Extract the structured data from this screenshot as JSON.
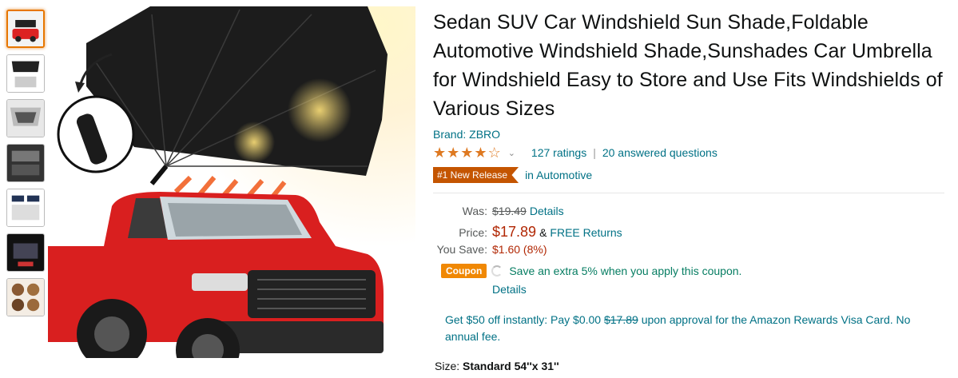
{
  "product": {
    "title": "Sedan SUV Car Windshield Sun Shade,Foldable Automotive Windshield Shade,Sunshades Car Umbrella for Windshield Easy to Store and Use Fits Windshields of Various Sizes",
    "brand": "Brand: ZBRO",
    "rating": 4.0,
    "ratings_count": "127 ratings",
    "answered": "20 answered questions",
    "badge": "#1 New Release",
    "badge_category": "in Automotive"
  },
  "pricing": {
    "was_label": "Was:",
    "was_value": "$19.49",
    "was_details": "Details",
    "price_label": "Price:",
    "price_value": "$17.89",
    "amp": "&",
    "returns": "FREE Returns",
    "save_label": "You Save:",
    "save_value": "$1.60 (8%)"
  },
  "coupon": {
    "tag": "Coupon",
    "text": "Save an extra 5% when you apply this coupon.",
    "details": "Details"
  },
  "promo": {
    "part1": "Get $50 off instantly: Pay $0.00",
    "strike": "$17.89",
    "part2": "upon approval for the Amazon Rewards Visa Card. No annual fee."
  },
  "size": {
    "label": "Size:",
    "value": "Standard 54''x 31''"
  },
  "colors": {
    "link": "#007185",
    "price": "#b12704",
    "badge": "#c45500",
    "coupon": "#f08804",
    "star": "#de7921"
  }
}
